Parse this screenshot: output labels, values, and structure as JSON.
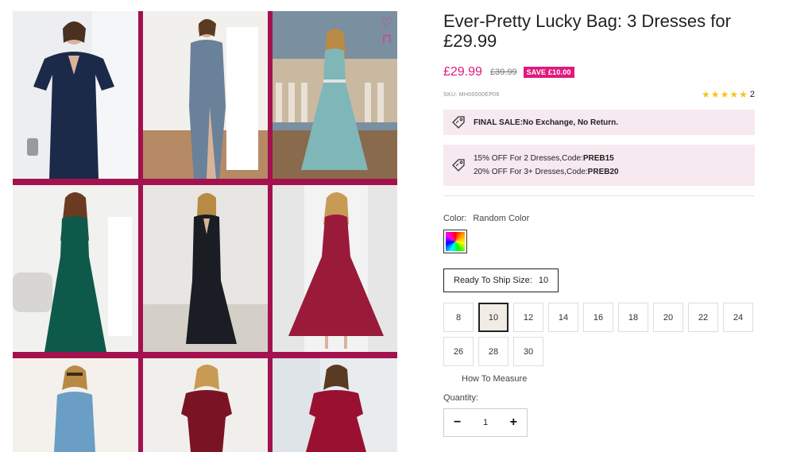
{
  "product": {
    "title": "Ever-Pretty Lucky Bag: 3 Dresses for £29.99",
    "price": "£29.99",
    "old_price": "£39.99",
    "save_badge": "SAVE £10.00",
    "sku": "SKU: MH00000EP06",
    "rating_count": "2",
    "stars": 5
  },
  "notices": {
    "final_sale": "FINAL SALE:No Exchange, No Return.",
    "promo_line1_text": "15% OFF For 2 Dresses,Code:",
    "promo_line1_code": "PREB15",
    "promo_line2_text": "20% OFF For 3+ Dresses,Code:",
    "promo_line2_code": "PREB20"
  },
  "color": {
    "label": "Color:",
    "value": "Random Color"
  },
  "size": {
    "ready_label": "Ready To Ship Size:",
    "ready_value": "10",
    "options": [
      "8",
      "10",
      "12",
      "14",
      "16",
      "18",
      "20",
      "22",
      "24",
      "26",
      "28",
      "30"
    ],
    "selected": "10",
    "how_to_measure": "How To Measure"
  },
  "quantity": {
    "label": "Quantity:",
    "value": "1",
    "minus": "−",
    "plus": "+"
  },
  "colors": {
    "accent": "#e0197d",
    "gallery_bg": "#a3114f",
    "notice_bg": "#f6e9ef",
    "star": "#f5c518"
  }
}
